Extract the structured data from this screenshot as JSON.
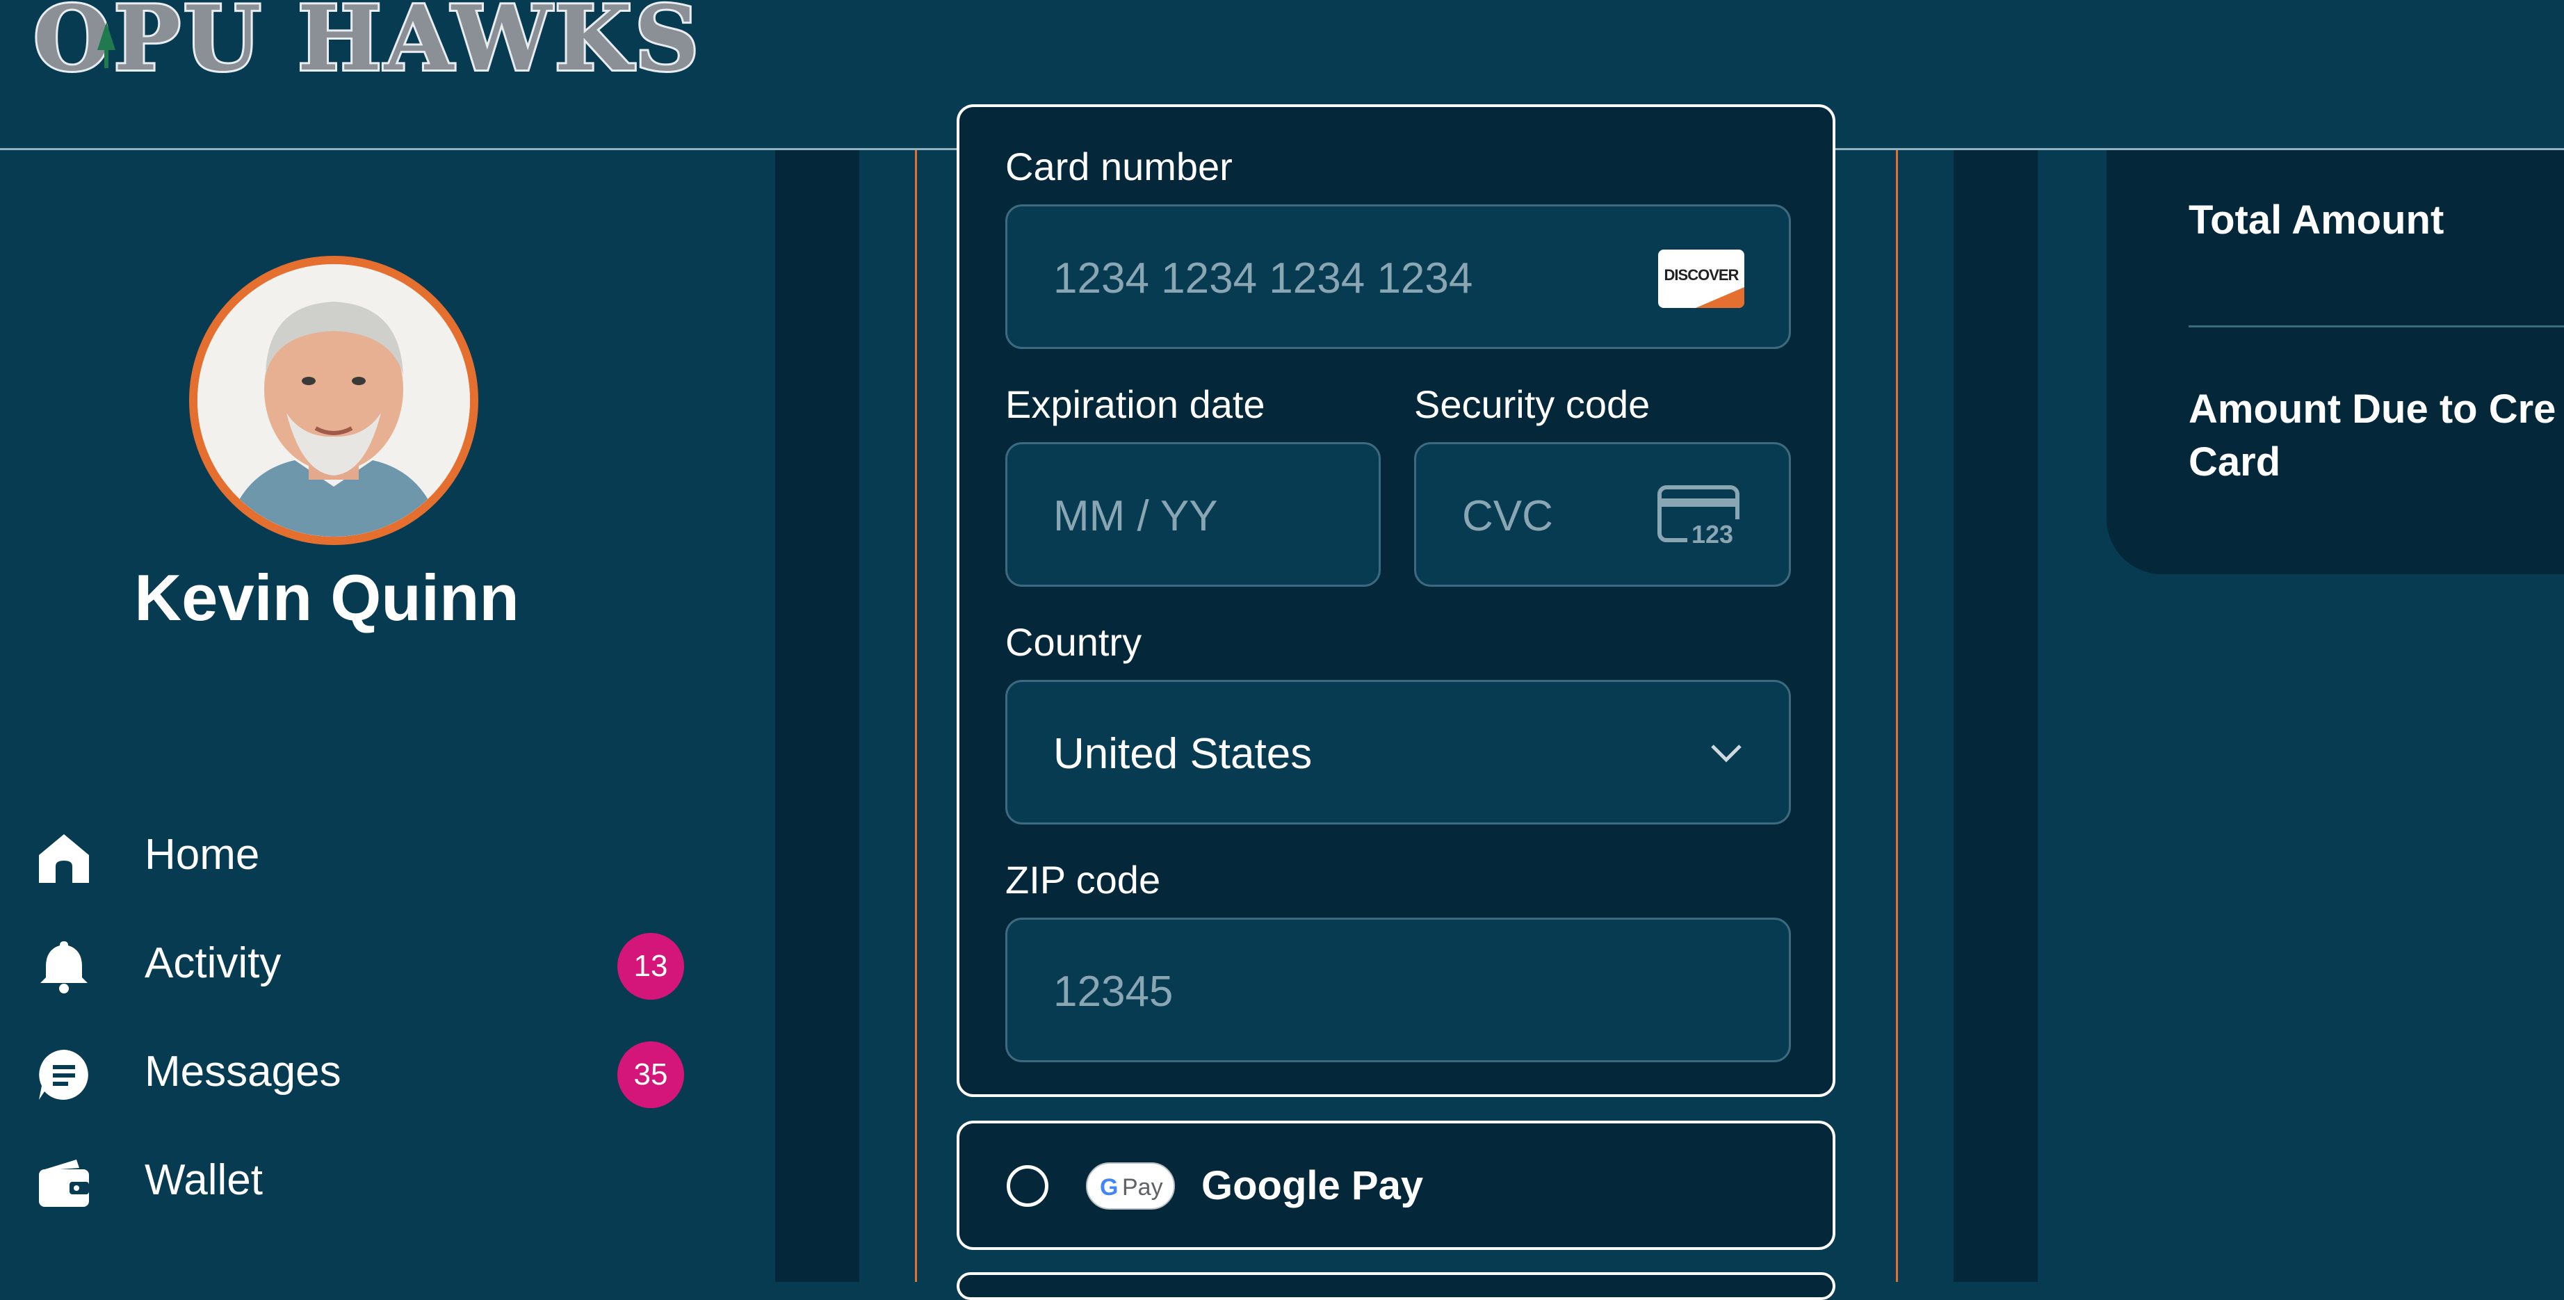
{
  "header": {
    "logo_text": "OPU HAWKS"
  },
  "profile": {
    "name": "Kevin Quinn"
  },
  "nav": {
    "items": [
      {
        "label": "Home",
        "icon": "home-icon"
      },
      {
        "label": "Activity",
        "icon": "bell-icon",
        "badge": "13"
      },
      {
        "label": "Messages",
        "icon": "message-icon",
        "badge": "35"
      },
      {
        "label": "Wallet",
        "icon": "wallet-icon"
      }
    ]
  },
  "payment_form": {
    "card_number_label": "Card number",
    "card_number_placeholder": "1234 1234 1234 1234",
    "card_brand": "DISCOVER",
    "expiration_label": "Expiration date",
    "expiration_placeholder": "MM / YY",
    "security_label": "Security code",
    "security_placeholder": "CVC",
    "cvc_icon_text": "123",
    "country_label": "Country",
    "country_value": "United States",
    "zip_label": "ZIP code",
    "zip_placeholder": "12345"
  },
  "google_pay": {
    "label": "Google Pay",
    "pill_g": "G",
    "pill_pay": "Pay"
  },
  "summary": {
    "total_label": "Total Amount",
    "due_label_line1": "Amount Due to Cre",
    "due_label_line2": "Card"
  },
  "colors": {
    "background": "#063b52",
    "panel_dark": "#04273a",
    "accent_orange": "#e46f2e",
    "badge_pink": "#d4157a",
    "field_border": "#3d6a7f"
  }
}
